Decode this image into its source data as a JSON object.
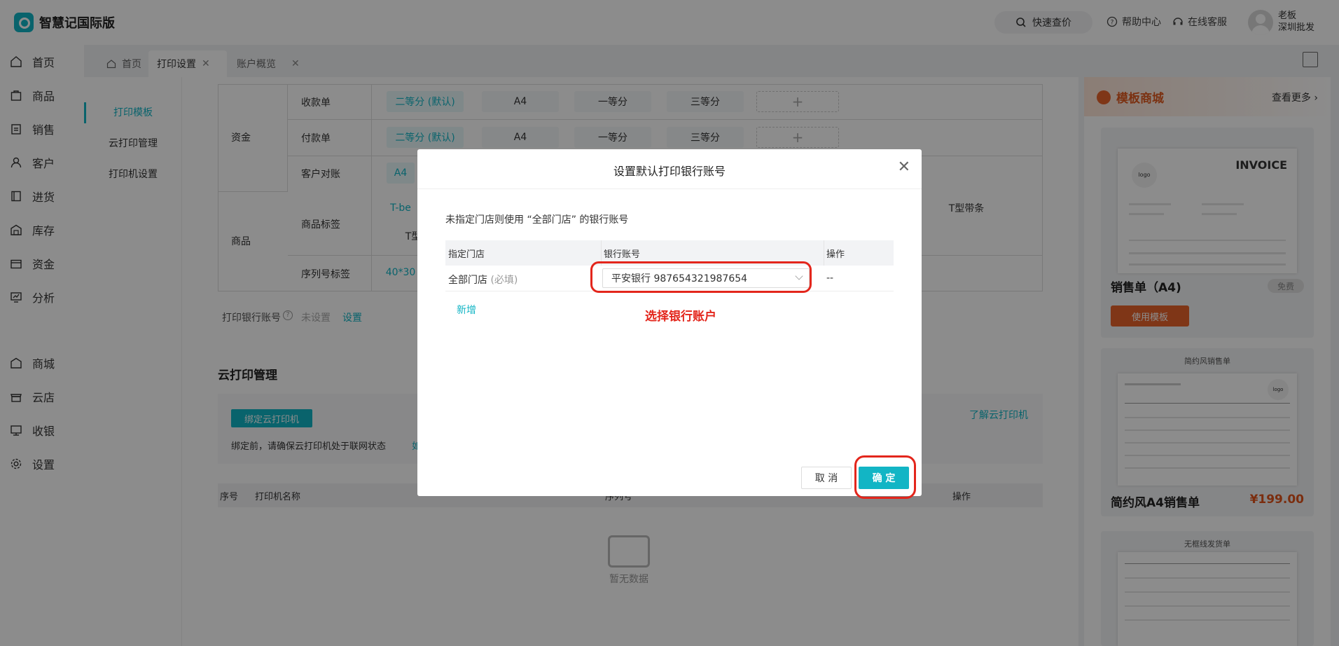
{
  "app": {
    "name": "智慧记国际版"
  },
  "header": {
    "quick_price": "快速查价",
    "help": "帮助中心",
    "service": "在线客服",
    "user_name": "老板",
    "user_store": "深圳批发"
  },
  "sidenav": {
    "items": [
      "首页",
      "商品",
      "销售",
      "客户",
      "进货",
      "库存",
      "资金",
      "分析",
      "商城",
      "云店",
      "收银",
      "设置"
    ]
  },
  "tabs": [
    {
      "label": "首页"
    },
    {
      "label": "打印设置"
    },
    {
      "label": "账户概览"
    }
  ],
  "subnav": {
    "items": [
      "打印模板",
      "云打印管理",
      "打印机设置"
    ]
  },
  "template_table": {
    "group_fund": "资金",
    "group_goods": "商品",
    "rows": [
      {
        "name": "收款单",
        "options": [
          "二等分 (默认)",
          "A4",
          "一等分",
          "三等分"
        ]
      },
      {
        "name": "付款单",
        "options": [
          "二等分 (默认)",
          "A4",
          "一等分",
          "三等分"
        ]
      },
      {
        "name": "客户对账",
        "options": [
          "A4"
        ]
      },
      {
        "name": "商品标签",
        "options": [
          "T-be",
          "T型",
          "T型带条"
        ]
      },
      {
        "name": "序列号标签",
        "options": [
          "40*30"
        ]
      }
    ]
  },
  "print_bank": {
    "label": "打印银行账号",
    "status": "未设置",
    "action": "设置"
  },
  "cloud_print": {
    "title": "云打印管理",
    "bind_button": "绑定云打印机",
    "notice": "绑定前，请确保云打印机处于联网状态",
    "notice_cut": "如",
    "learn_more": "了解云打印机",
    "columns": [
      "序号",
      "打印机名称",
      "序列号",
      "操作"
    ],
    "empty": "暂无数据"
  },
  "shop": {
    "title": "模板商城",
    "more": "查看更多",
    "cards": [
      {
        "name": "销售单（A4)",
        "badge": "免费",
        "button": "使用模板",
        "preview_title": "INVOICE",
        "preview_logo": "logo"
      },
      {
        "name": "简约风A4销售单",
        "price": "¥199.00",
        "preview_title": "简约风销售单",
        "preview_logo": "logo"
      },
      {
        "name": "",
        "preview_title": "无框线发货单"
      }
    ]
  },
  "modal": {
    "title": "设置默认打印银行账号",
    "hint": "未指定门店则使用 “全部门店” 的银行账号",
    "columns": [
      "指定门店",
      "银行账号",
      "操作"
    ],
    "row": {
      "store": "全部门店",
      "required": "(必填)",
      "account": "平安银行 987654321987654",
      "op": "--"
    },
    "add": "新增",
    "annotation": "选择银行账户",
    "cancel": "取 消",
    "confirm": "确 定"
  },
  "colors": {
    "accent": "#12b5c5",
    "annotation": "#e3261c",
    "shop": "#e8632b"
  }
}
